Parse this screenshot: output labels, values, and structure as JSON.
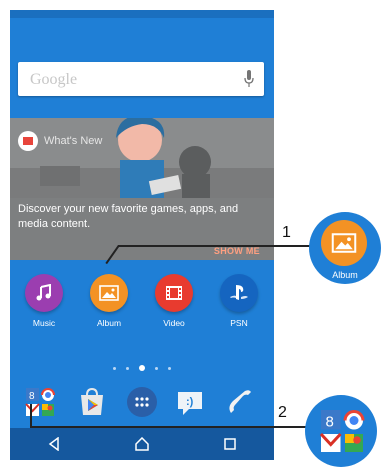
{
  "search": {
    "placeholder": "Google",
    "mic_icon": "mic-icon"
  },
  "card": {
    "brand_label": "What's New",
    "description": "Discover your new favorite games, apps, and media content.",
    "cta": "SHOW ME"
  },
  "apps": [
    {
      "label": "Music",
      "icon": "music-note-icon",
      "color": "#9b3eb0"
    },
    {
      "label": "Album",
      "icon": "picture-icon",
      "color": "#f39224"
    },
    {
      "label": "Video",
      "icon": "film-icon",
      "color": "#e83b2f"
    },
    {
      "label": "PSN",
      "icon": "playstation-icon",
      "color": "#1565c0"
    }
  ],
  "page_indicator": {
    "count": 5,
    "active": 2
  },
  "dock": [
    "google-folder",
    "play-store",
    "app-drawer",
    "messaging",
    "phone"
  ],
  "callouts": {
    "one": {
      "number": "1",
      "label": "Album"
    },
    "two": {
      "number": "2"
    }
  },
  "colors": {
    "background": "#1f7fd6",
    "album": "#f39224",
    "accent": "#ff9f80"
  }
}
